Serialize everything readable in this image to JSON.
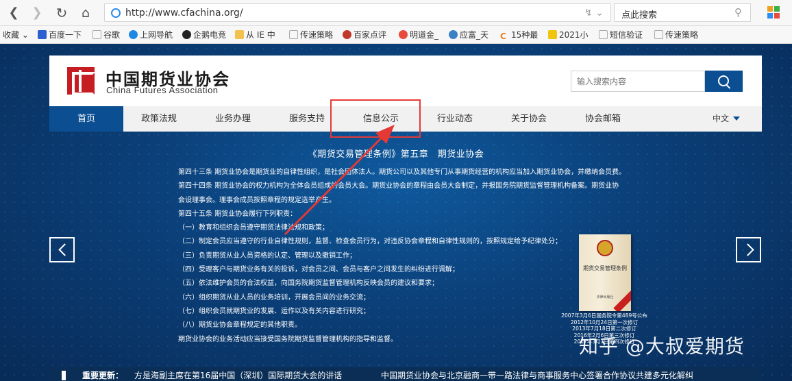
{
  "browser": {
    "url": "http://www.cfachina.org/",
    "search_placeholder": "点此搜索",
    "bookmarks": [
      "收藏",
      "百度一下",
      "谷歌",
      "上网导航",
      "企鹅电竞",
      "从 IE 中",
      "传速策略",
      "百家点评",
      "明道金_",
      "应富_天",
      "15种最",
      "2021小",
      "短信验证",
      "传速策略"
    ]
  },
  "site": {
    "logo_cn": "中国期货业协会",
    "logo_en": "China Futures Association",
    "search_placeholder": "输入搜索内容",
    "nav": [
      "首页",
      "政策法规",
      "业务办理",
      "服务支持",
      "信息公示",
      "行业动态",
      "关于协会",
      "协会邮箱"
    ],
    "lang": "中文"
  },
  "content": {
    "title": "《期货交易管理条例》第五章　期货业协会",
    "lines": [
      "第四十三条  期货业协会是期货业的自律性组织，是社会团体法人。期货公司以及其他专门从事期货经营的机构应当加入期货业协会，并缴纳会员费。",
      "第四十四条  期货业协会的权力机构为全体会员组成的会员大会。期货业协会的章程由会员大会制定，并报国务院期货监督管理机构备案。期货业协",
      "会设理事会。理事会成员按照章程的规定选举产生。",
      "第四十五条  期货业协会履行下列职责：",
      "（一）教育和组织会员遵守期货法律法规和政策；",
      "（二）制定会员应当遵守的行业自律性规则，监督、检查会员行为，对违反协会章程和自律性规则的，按照规定给予纪律处分；",
      "（三）负责期货从业人员资格的认定、管理以及撤销工作；",
      "（四）受理客户与期货业务有关的投诉，对会员之间、会员与客户之间发生的纠纷进行调解；",
      "（五）依法维护会员的合法权益，向国务院期货监督管理机构反映会员的建议和要求；",
      "（六）组织期货从业人员的业务培训，开展会员间的业务交流；",
      "（七）组织会员就期货业的发展、运作以及有关内容进行研究；",
      "（八）期货业协会章程规定的其他职责。",
      "期货业协会的业务活动应当接受国务院期货监督管理机构的指导和监督。"
    ],
    "book_title": "期货交易管理条例",
    "book_publisher": "法律出版社",
    "book_notes": [
      "2007年3月6日国务院令第489号公布",
      "2012年10月24日第一次修订",
      "2013年7月18日第二次修订",
      "2016年2月6日第三次修订",
      "2017年3月1日第四次修订"
    ]
  },
  "watermark": "知乎 @大叔爱期货",
  "news": {
    "label": "重要更新：",
    "item1": "方是海副主席在第16届中国（深圳）国际期货大会的讲话",
    "item2": "中国期货业协会与北京融商一带一路法律与商事服务中心签署合作协议共建多元化解纠"
  },
  "colors": {
    "brand": "#0b4f92",
    "logo_red": "#c61d23",
    "annotation": "#e53935"
  }
}
